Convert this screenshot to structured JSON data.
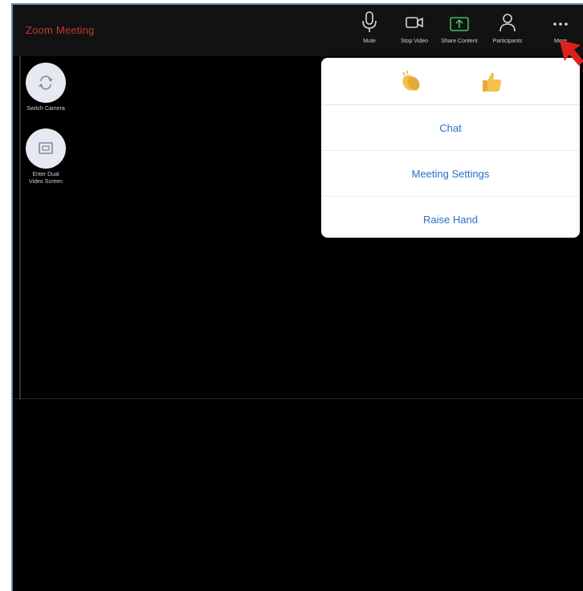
{
  "window": {
    "title": "Zoom Meeting"
  },
  "toolbar": {
    "items": [
      {
        "label": "Mute",
        "icon": "microphone-icon"
      },
      {
        "label": "Stop Video",
        "icon": "video-camera-icon"
      },
      {
        "label": "Share Content",
        "icon": "share-screen-icon"
      },
      {
        "label": "Participants",
        "icon": "participants-icon"
      },
      {
        "label": "More",
        "icon": "more-dots-icon"
      }
    ]
  },
  "side": {
    "buttons": [
      {
        "label_lines": [
          "Switch Camera"
        ],
        "icon": "switch-camera-icon"
      },
      {
        "label_lines": [
          "Enter Dual",
          "Video Screen"
        ],
        "icon": "dual-screen-icon"
      }
    ]
  },
  "popup": {
    "reactions": [
      {
        "name": "clap-reaction",
        "icon": "clapping-hands-icon"
      },
      {
        "name": "thumbs-up-reaction",
        "icon": "thumbs-up-icon"
      }
    ],
    "items": [
      "Chat",
      "Meeting Settings",
      "Raise Hand"
    ]
  },
  "colors": {
    "background": "#000000",
    "topbar": "#121212",
    "title": "#c0392b",
    "popup_text": "#2a6fc4",
    "arrow": "#e02020"
  }
}
